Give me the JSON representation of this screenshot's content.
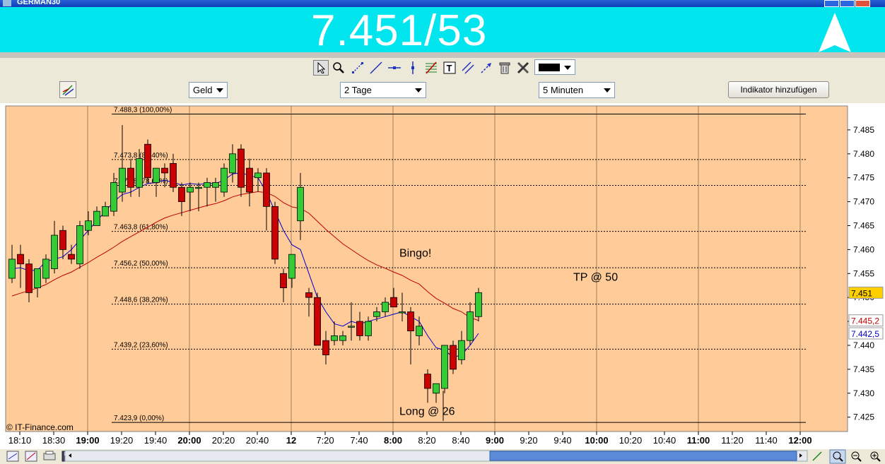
{
  "window": {
    "title": "GERMAN30"
  },
  "quote": {
    "price": "7.451/53",
    "direction": "up"
  },
  "toolbar": {
    "tools": [
      "pointer-icon",
      "zoom-icon",
      "trendline-icon",
      "line-icon",
      "horizontal-line-icon",
      "vertical-line-icon",
      "fibonacci-icon",
      "text-icon",
      "channel-icon",
      "arrows-icon",
      "trash-icon",
      "tools-icon"
    ],
    "line_color": "#000000"
  },
  "controls": {
    "price_type": "Geld",
    "range": "2 Tage",
    "interval": "5 Minuten",
    "add_indicator": "Indikator hinzufügen"
  },
  "chart_data": {
    "type": "candlestick",
    "instrument": "GERMAN30",
    "ylim": [
      7.422,
      7.49
    ],
    "y_ticks": [
      "7.425",
      "7.430",
      "7.435",
      "7.440",
      "7.445",
      "7.450",
      "7.455",
      "7.460",
      "7.465",
      "7.470",
      "7.475",
      "7.480",
      "7.485"
    ],
    "x_labels": [
      "18:10",
      "18:30",
      "19:00",
      "19:20",
      "19:40",
      "20:00",
      "20:20",
      "20:40",
      "12",
      "7:20",
      "7:40",
      "8:00",
      "8:20",
      "8:40",
      "9:00",
      "9:20",
      "9:40",
      "10:00",
      "10:20",
      "10:40",
      "11:00",
      "11:20",
      "11:40",
      "12:00"
    ],
    "bold_x_labels": [
      "19:00",
      "20:00",
      "12",
      "8:00",
      "9:00",
      "10:00",
      "11:00",
      "12:00"
    ],
    "fib_levels": [
      {
        "label": "7.488,3 (100,00%)",
        "value": 7.4883
      },
      {
        "label": "7.473,8 (85,40%)",
        "value": 7.4788
      },
      {
        "label": "7.473,8 (78,60%)",
        "value": 7.4734
      },
      {
        "label": "7.463,8 (61,80%)",
        "value": 7.4638
      },
      {
        "label": "7.456,2 (50,00%)",
        "value": 7.4562
      },
      {
        "label": "7.448,6 (38,20%)",
        "value": 7.4486
      },
      {
        "label": "7.439,2 (23,60%)",
        "value": 7.4392
      },
      {
        "label": "7.423,9 (0,00%)",
        "value": 7.4239
      }
    ],
    "price_tags": [
      {
        "text": "7.451",
        "value": 7.451,
        "color": "#ffd000",
        "textcolor": "#000000"
      },
      {
        "text": "7.445,2",
        "value": 7.4452,
        "color": "#ffffff",
        "textcolor": "#c00000"
      },
      {
        "text": "7.442,5",
        "value": 7.4425,
        "color": "#ffffff",
        "textcolor": "#0000c0"
      }
    ],
    "annotations": [
      {
        "text": "Bingo!",
        "x": 46.5,
        "value": 7.4585
      },
      {
        "text": "TP @ 50",
        "x": 67,
        "value": 7.4535
      },
      {
        "text": "Long @ 26",
        "x": 46.5,
        "value": 7.4255
      }
    ],
    "watermark": "© IT-Finance.com",
    "candles": [
      {
        "o": 7.454,
        "h": 7.461,
        "l": 7.453,
        "c": 7.458
      },
      {
        "o": 7.459,
        "h": 7.461,
        "l": 7.452,
        "c": 7.457
      },
      {
        "o": 7.457,
        "h": 7.458,
        "l": 7.449,
        "c": 7.451
      },
      {
        "o": 7.452,
        "h": 7.456,
        "l": 7.45,
        "c": 7.456
      },
      {
        "o": 7.454,
        "h": 7.459,
        "l": 7.453,
        "c": 7.458
      },
      {
        "o": 7.456,
        "h": 7.466,
        "l": 7.455,
        "c": 7.463
      },
      {
        "o": 7.464,
        "h": 7.465,
        "l": 7.458,
        "c": 7.46
      },
      {
        "o": 7.459,
        "h": 7.461,
        "l": 7.457,
        "c": 7.458
      },
      {
        "o": 7.457,
        "h": 7.466,
        "l": 7.456,
        "c": 7.465
      },
      {
        "o": 7.464,
        "h": 7.468,
        "l": 7.463,
        "c": 7.466
      },
      {
        "o": 7.465,
        "h": 7.469,
        "l": 7.465,
        "c": 7.468
      },
      {
        "o": 7.467,
        "h": 7.47,
        "l": 7.467,
        "c": 7.469
      },
      {
        "o": 7.468,
        "h": 7.476,
        "l": 7.467,
        "c": 7.474
      },
      {
        "o": 7.472,
        "h": 7.486,
        "l": 7.47,
        "c": 7.477
      },
      {
        "o": 7.477,
        "h": 7.479,
        "l": 7.471,
        "c": 7.473
      },
      {
        "o": 7.473,
        "h": 7.481,
        "l": 7.471,
        "c": 7.479
      },
      {
        "o": 7.482,
        "h": 7.483,
        "l": 7.474,
        "c": 7.475
      },
      {
        "o": 7.474,
        "h": 7.477,
        "l": 7.471,
        "c": 7.477
      },
      {
        "o": 7.477,
        "h": 7.478,
        "l": 7.473,
        "c": 7.476
      },
      {
        "o": 7.478,
        "h": 7.48,
        "l": 7.472,
        "c": 7.473
      },
      {
        "o": 7.473,
        "h": 7.474,
        "l": 7.467,
        "c": 7.47
      },
      {
        "o": 7.472,
        "h": 7.474,
        "l": 7.468,
        "c": 7.473
      },
      {
        "o": 7.473,
        "h": 7.474,
        "l": 7.468,
        "c": 7.473
      },
      {
        "o": 7.473,
        "h": 7.475,
        "l": 7.469,
        "c": 7.474
      },
      {
        "o": 7.473,
        "h": 7.475,
        "l": 7.47,
        "c": 7.474
      },
      {
        "o": 7.472,
        "h": 7.478,
        "l": 7.471,
        "c": 7.477
      },
      {
        "o": 7.476,
        "h": 7.482,
        "l": 7.474,
        "c": 7.48
      },
      {
        "o": 7.481,
        "h": 7.482,
        "l": 7.471,
        "c": 7.473
      },
      {
        "o": 7.477,
        "h": 7.479,
        "l": 7.469,
        "c": 7.472
      },
      {
        "o": 7.475,
        "h": 7.477,
        "l": 7.472,
        "c": 7.476
      },
      {
        "o": 7.476,
        "h": 7.477,
        "l": 7.464,
        "c": 7.469
      },
      {
        "o": 7.469,
        "h": 7.47,
        "l": 7.457,
        "c": 7.458
      },
      {
        "o": 7.455,
        "h": 7.456,
        "l": 7.449,
        "c": 7.452
      },
      {
        "o": 7.454,
        "h": 7.459,
        "l": 7.452,
        "c": 7.459
      },
      {
        "o": 7.466,
        "h": 7.476,
        "l": 7.462,
        "c": 7.473
      },
      {
        "o": 7.451,
        "h": 7.452,
        "l": 7.446,
        "c": 7.45
      },
      {
        "o": 7.45,
        "h": 7.451,
        "l": 7.44,
        "c": 7.44
      },
      {
        "o": 7.441,
        "h": 7.443,
        "l": 7.436,
        "c": 7.438
      },
      {
        "o": 7.441,
        "h": 7.445,
        "l": 7.44,
        "c": 7.442
      },
      {
        "o": 7.441,
        "h": 7.443,
        "l": 7.44,
        "c": 7.442
      },
      {
        "o": 7.444,
        "h": 7.449,
        "l": 7.441,
        "c": 7.444
      },
      {
        "o": 7.445,
        "h": 7.447,
        "l": 7.441,
        "c": 7.442
      },
      {
        "o": 7.442,
        "h": 7.446,
        "l": 7.441,
        "c": 7.445
      },
      {
        "o": 7.446,
        "h": 7.448,
        "l": 7.445,
        "c": 7.447
      },
      {
        "o": 7.447,
        "h": 7.45,
        "l": 7.446,
        "c": 7.449
      },
      {
        "o": 7.45,
        "h": 7.452,
        "l": 7.448,
        "c": 7.448
      },
      {
        "o": 7.447,
        "h": 7.451,
        "l": 7.445,
        "c": 7.447
      },
      {
        "o": 7.447,
        "h": 7.448,
        "l": 7.436,
        "c": 7.443
      },
      {
        "o": 7.442,
        "h": 7.446,
        "l": 7.44,
        "c": 7.444
      },
      {
        "o": 7.434,
        "h": 7.435,
        "l": 7.428,
        "c": 7.431
      },
      {
        "o": 7.43,
        "h": 7.432,
        "l": 7.428,
        "c": 7.432
      },
      {
        "o": 7.431,
        "h": 7.44,
        "l": 7.43,
        "c": 7.44
      },
      {
        "o": 7.44,
        "h": 7.441,
        "l": 7.434,
        "c": 7.435
      },
      {
        "o": 7.437,
        "h": 7.443,
        "l": 7.436,
        "c": 7.441
      },
      {
        "o": 7.441,
        "h": 7.449,
        "l": 7.44,
        "c": 7.447
      },
      {
        "o": 7.446,
        "h": 7.452,
        "l": 7.445,
        "c": 7.451
      }
    ],
    "series": [
      {
        "values": [
          7.4503,
          7.4509,
          7.4514,
          7.452,
          7.4527,
          7.4537,
          7.4546,
          7.4553,
          7.4563,
          7.4573,
          7.4584,
          7.4594,
          7.4605,
          7.4617,
          7.4627,
          7.4637,
          7.4647,
          7.4657,
          7.4666,
          7.4672,
          7.4677,
          7.4682,
          7.4687,
          7.4692,
          7.4696,
          7.4702,
          7.471,
          7.4715,
          7.4718,
          7.4721,
          7.4719,
          7.4711,
          7.4698,
          7.4689,
          7.4686,
          7.4676,
          7.4659,
          7.4642,
          7.4627,
          7.4612,
          7.46,
          7.4588,
          7.4577,
          7.4568,
          7.4561,
          7.4553,
          7.4546,
          7.4536,
          7.4528,
          7.4512,
          7.4498,
          7.4488,
          7.4477,
          7.447,
          7.4458,
          7.4452
        ],
        "color": "#c00000"
      },
      {
        "values": [
          7.456,
          7.4562,
          7.4556,
          7.4557,
          7.4575,
          7.458,
          7.4585,
          7.46,
          7.462,
          7.464,
          7.466,
          7.468,
          7.47,
          7.4715,
          7.472,
          7.473,
          7.4738,
          7.474,
          7.4745,
          7.474,
          7.4735,
          7.4738,
          7.4736,
          7.4738,
          7.4738,
          7.4745,
          7.4758,
          7.476,
          7.4755,
          7.475,
          7.472,
          7.468,
          7.464,
          7.461,
          7.46,
          7.455,
          7.45,
          7.447,
          7.4445,
          7.444,
          7.445,
          7.4445,
          7.445,
          7.4455,
          7.446,
          7.4465,
          7.447,
          7.446,
          7.445,
          7.442,
          7.4395,
          7.439,
          7.4375,
          7.438,
          7.44,
          7.4425
        ],
        "color": "#0000cc"
      }
    ]
  },
  "footer": {
    "icons": [
      "chart-type-icon",
      "draw-icon",
      "print-icon",
      "save-icon"
    ],
    "zoom_icons": [
      "zoom-fit-icon",
      "zoom-out-icon",
      "zoom-in-icon"
    ]
  }
}
